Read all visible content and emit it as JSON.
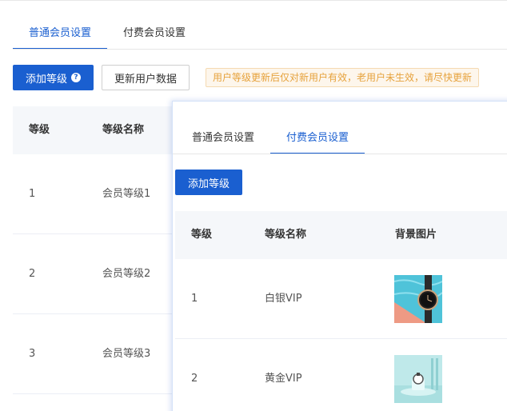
{
  "tabs": [
    {
      "label": "普通会员设置",
      "active": true
    },
    {
      "label": "付费会员设置",
      "active": false
    }
  ],
  "toolbar": {
    "add_label": "添加等级",
    "help_icon": "question-icon",
    "help_glyph": "?",
    "refresh_label": "更新用户数据",
    "notice": "用户等级更新后仅对新用户有效，老用户未生效，请尽快更新"
  },
  "table": {
    "headers": [
      "等级",
      "等级名称"
    ],
    "rows": [
      {
        "level": "1",
        "name": "会员等级1"
      },
      {
        "level": "2",
        "name": "会员等级2"
      },
      {
        "level": "3",
        "name": "会员等级3"
      }
    ]
  },
  "overlay": {
    "tabs": [
      {
        "label": "普通会员设置",
        "active": false
      },
      {
        "label": "付费会员设置",
        "active": true
      }
    ],
    "add_label": "添加等级",
    "headers": [
      "等级",
      "等级名称",
      "背景图片"
    ],
    "rows": [
      {
        "level": "1",
        "name": "白银VIP",
        "image": "watch-on-pool-image"
      },
      {
        "level": "2",
        "name": "黄金VIP",
        "image": "watch-on-stand-image"
      }
    ]
  },
  "colors": {
    "primary": "#1a5fd0",
    "notice_bg": "#fdf6ec",
    "notice_text": "#e6a23c",
    "header_bg": "#f5f7fa"
  }
}
